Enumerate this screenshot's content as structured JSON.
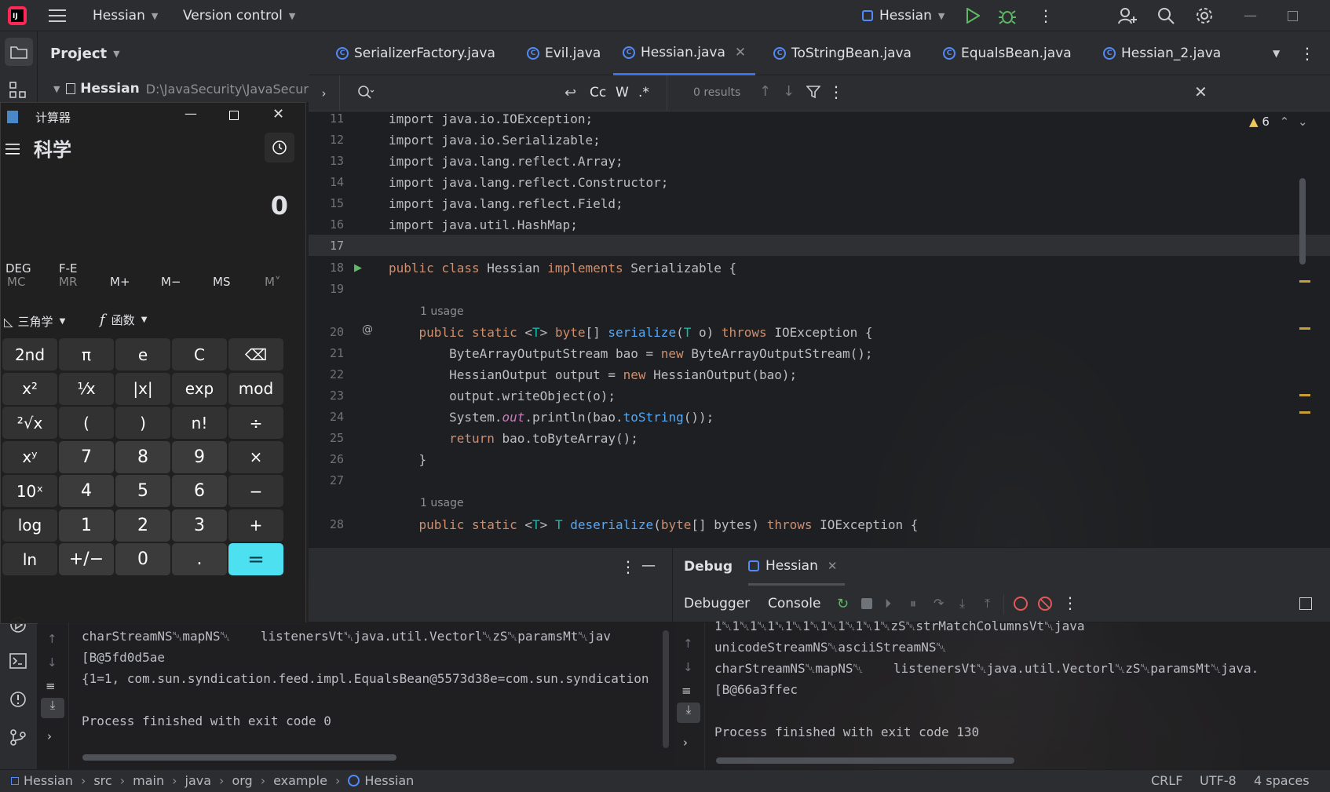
{
  "titlebar": {
    "project": "Hessian",
    "vcs": "Version control",
    "run_config": "Hessian"
  },
  "project_panel": {
    "title": "Project",
    "root_name": "Hessian",
    "root_path": "D:\\JavaSecurity\\JavaSecur"
  },
  "tabs": [
    {
      "label": "SerializerFactory.java",
      "icon": "C"
    },
    {
      "label": "Evil.java",
      "icon": "C"
    },
    {
      "label": "Hessian.java",
      "icon": "C"
    },
    {
      "label": "ToStringBean.java",
      "icon": "C"
    },
    {
      "label": "EqualsBean.java",
      "icon": "C"
    },
    {
      "label": "Hessian_2.java",
      "icon": "C"
    }
  ],
  "findbar": {
    "case": "Cc",
    "word": "W",
    "regex": ".*",
    "results": "0 results"
  },
  "editor": {
    "warnings": "6",
    "usage1": "1 usage",
    "usage2": "1 usage",
    "lines": [
      "11",
      "12",
      "13",
      "14",
      "15",
      "16",
      "17",
      "18",
      "19",
      "20",
      "21",
      "22",
      "23",
      "24",
      "25",
      "26",
      "27",
      "28"
    ],
    "code": {
      "l11": "import java.io.IOException;",
      "l12": "import java.io.Serializable;",
      "l13": "import java.lang.reflect.Array;",
      "l14": "import java.lang.reflect.Constructor;",
      "l15": "import java.lang.reflect.Field;",
      "l16": "import java.util.HashMap;"
    }
  },
  "calculator": {
    "title": "计算器",
    "mode": "科学",
    "display": "0",
    "deg": "DEG",
    "fe": "F-E",
    "memory": [
      "MC",
      "MR",
      "M+",
      "M−",
      "MS",
      "M˅"
    ],
    "trig": "三角学",
    "func": "函数",
    "keys": [
      [
        "2nd",
        "π",
        "e",
        "C",
        "⌫"
      ],
      [
        "x²",
        "¹⁄x",
        "|x|",
        "exp",
        "mod"
      ],
      [
        "²√x",
        "(",
        ")",
        "n!",
        "÷"
      ],
      [
        "xʸ",
        "7",
        "8",
        "9",
        "×"
      ],
      [
        "10ˣ",
        "4",
        "5",
        "6",
        "−"
      ],
      [
        "log",
        "1",
        "2",
        "3",
        "+"
      ],
      [
        "ln",
        "+/−",
        "0",
        ".",
        "="
      ]
    ]
  },
  "debug": {
    "tab": "Debug",
    "session": "Hessian",
    "debugger": "Debugger",
    "console": "Console"
  },
  "console_left": [
    "charStreamNS␀mapNS␀    listenersVt␀java.util.Vectorl␀zS␀paramsMt␀jav",
    "[B@5fd0d5ae",
    "{1=1, com.sun.syndication.feed.impl.EqualsBean@5573d38e=com.sun.syndication",
    "",
    "Process finished with exit code 0"
  ],
  "console_right": [
    "1␀1␀1␀1␀1␀1␀1␀1␀1␀1␀zS␀strMatchColumnsVt␀java",
    "unicodeStreamNS␀asciiStreamNS␀",
    "charStreamNS␀mapNS␀    listenersVt␀java.util.Vectorl␀zS␀paramsMt␀java.",
    "[B@66a3ffec",
    "",
    "Process finished with exit code 130"
  ],
  "breadcrumb": [
    "Hessian",
    "src",
    "main",
    "java",
    "org",
    "example",
    "Hessian"
  ],
  "status": {
    "line_sep": "CRLF",
    "encoding": "UTF-8",
    "indent": "4 spaces"
  },
  "colors": {
    "accent": "#3574f0",
    "keyword": "#cf8e6d",
    "function": "#56a8f5",
    "equals": "#4ce0f0"
  }
}
